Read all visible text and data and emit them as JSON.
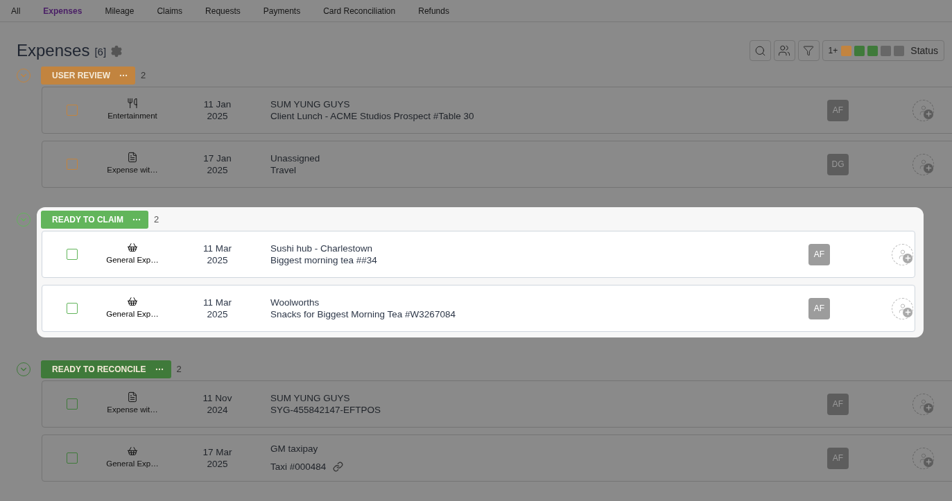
{
  "tabs": [
    {
      "label": "All",
      "selected": false
    },
    {
      "label": "Expenses",
      "selected": true
    },
    {
      "label": "Mileage",
      "selected": false
    },
    {
      "label": "Claims",
      "selected": false
    },
    {
      "label": "Requests",
      "selected": false
    },
    {
      "label": "Payments",
      "selected": false
    },
    {
      "label": "Card Reconciliation",
      "selected": false
    },
    {
      "label": "Refunds",
      "selected": false
    }
  ],
  "header": {
    "title": "Expenses",
    "count": "[6]",
    "status_filter": {
      "prefix": "1+",
      "label": "Status",
      "swatches": [
        {
          "color": "#c2843f"
        },
        {
          "color": "#3f7a3a"
        },
        {
          "color": "#3f7a3a"
        },
        {
          "color": "#676767"
        },
        {
          "color": "#676767"
        }
      ]
    }
  },
  "groups": [
    {
      "label": "USER REVIEW",
      "count": "2",
      "color": "#c2843f",
      "highlighted": false,
      "expanded": true,
      "rows": [
        {
          "kind": "cutlery",
          "category": "Entertainment",
          "date_day": "11 Jan",
          "date_year": "2025",
          "title": "SUM YUNG GUYS",
          "subtitle": "Client Lunch - ACME Studios Prospect #Table 30",
          "linked": false,
          "assignee": "AF",
          "checked": false
        },
        {
          "kind": "receipt",
          "category": "Expense wit…",
          "date_day": "17 Jan",
          "date_year": "2025",
          "title": "Unassigned",
          "subtitle": "Travel",
          "linked": false,
          "assignee": "DG",
          "checked": false
        }
      ]
    },
    {
      "label": "READY TO CLAIM",
      "count": "2",
      "color": "#62b55b",
      "highlighted": true,
      "expanded": true,
      "rows": [
        {
          "kind": "basket",
          "category": "General Exp…",
          "date_day": "11 Mar",
          "date_year": "2025",
          "title": "Sushi hub - Charlestown",
          "subtitle": "Biggest morning tea ##34",
          "linked": false,
          "assignee": "AF",
          "checked": false
        },
        {
          "kind": "basket",
          "category": "General Exp…",
          "date_day": "11 Mar",
          "date_year": "2025",
          "title": "Woolworths",
          "subtitle": "Snacks for Biggest Morning Tea #W3267084",
          "linked": false,
          "assignee": "AF",
          "checked": false
        }
      ]
    },
    {
      "label": "READY TO RECONCILE",
      "count": "2",
      "color": "#3f7a3a",
      "highlighted": false,
      "expanded": true,
      "rows": [
        {
          "kind": "receipt",
          "category": "Expense wit…",
          "date_day": "11 Nov",
          "date_year": "2024",
          "title": "SUM YUNG GUYS",
          "subtitle": "SYG-455842147-EFTPOS",
          "linked": false,
          "assignee": "AF",
          "checked": false
        },
        {
          "kind": "basket",
          "category": "General Exp…",
          "date_day": "17 Mar",
          "date_year": "2025",
          "title": "GM taxipay",
          "subtitle": "Taxi #000484",
          "linked": true,
          "assignee": "AF",
          "checked": false
        }
      ]
    }
  ]
}
